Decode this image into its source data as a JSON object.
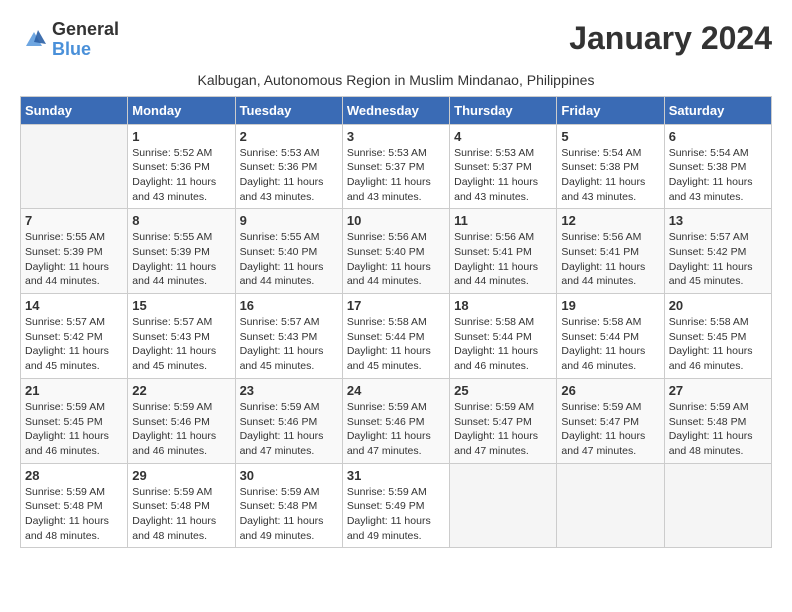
{
  "logo": {
    "line1": "General",
    "line2": "Blue"
  },
  "title": "January 2024",
  "subtitle": "Kalbugan, Autonomous Region in Muslim Mindanao, Philippines",
  "days_header": [
    "Sunday",
    "Monday",
    "Tuesday",
    "Wednesday",
    "Thursday",
    "Friday",
    "Saturday"
  ],
  "weeks": [
    [
      {
        "num": "",
        "sunrise": "",
        "sunset": "",
        "daylight": ""
      },
      {
        "num": "1",
        "sunrise": "Sunrise: 5:52 AM",
        "sunset": "Sunset: 5:36 PM",
        "daylight": "Daylight: 11 hours and 43 minutes."
      },
      {
        "num": "2",
        "sunrise": "Sunrise: 5:53 AM",
        "sunset": "Sunset: 5:36 PM",
        "daylight": "Daylight: 11 hours and 43 minutes."
      },
      {
        "num": "3",
        "sunrise": "Sunrise: 5:53 AM",
        "sunset": "Sunset: 5:37 PM",
        "daylight": "Daylight: 11 hours and 43 minutes."
      },
      {
        "num": "4",
        "sunrise": "Sunrise: 5:53 AM",
        "sunset": "Sunset: 5:37 PM",
        "daylight": "Daylight: 11 hours and 43 minutes."
      },
      {
        "num": "5",
        "sunrise": "Sunrise: 5:54 AM",
        "sunset": "Sunset: 5:38 PM",
        "daylight": "Daylight: 11 hours and 43 minutes."
      },
      {
        "num": "6",
        "sunrise": "Sunrise: 5:54 AM",
        "sunset": "Sunset: 5:38 PM",
        "daylight": "Daylight: 11 hours and 43 minutes."
      }
    ],
    [
      {
        "num": "7",
        "sunrise": "Sunrise: 5:55 AM",
        "sunset": "Sunset: 5:39 PM",
        "daylight": "Daylight: 11 hours and 44 minutes."
      },
      {
        "num": "8",
        "sunrise": "Sunrise: 5:55 AM",
        "sunset": "Sunset: 5:39 PM",
        "daylight": "Daylight: 11 hours and 44 minutes."
      },
      {
        "num": "9",
        "sunrise": "Sunrise: 5:55 AM",
        "sunset": "Sunset: 5:40 PM",
        "daylight": "Daylight: 11 hours and 44 minutes."
      },
      {
        "num": "10",
        "sunrise": "Sunrise: 5:56 AM",
        "sunset": "Sunset: 5:40 PM",
        "daylight": "Daylight: 11 hours and 44 minutes."
      },
      {
        "num": "11",
        "sunrise": "Sunrise: 5:56 AM",
        "sunset": "Sunset: 5:41 PM",
        "daylight": "Daylight: 11 hours and 44 minutes."
      },
      {
        "num": "12",
        "sunrise": "Sunrise: 5:56 AM",
        "sunset": "Sunset: 5:41 PM",
        "daylight": "Daylight: 11 hours and 44 minutes."
      },
      {
        "num": "13",
        "sunrise": "Sunrise: 5:57 AM",
        "sunset": "Sunset: 5:42 PM",
        "daylight": "Daylight: 11 hours and 45 minutes."
      }
    ],
    [
      {
        "num": "14",
        "sunrise": "Sunrise: 5:57 AM",
        "sunset": "Sunset: 5:42 PM",
        "daylight": "Daylight: 11 hours and 45 minutes."
      },
      {
        "num": "15",
        "sunrise": "Sunrise: 5:57 AM",
        "sunset": "Sunset: 5:43 PM",
        "daylight": "Daylight: 11 hours and 45 minutes."
      },
      {
        "num": "16",
        "sunrise": "Sunrise: 5:57 AM",
        "sunset": "Sunset: 5:43 PM",
        "daylight": "Daylight: 11 hours and 45 minutes."
      },
      {
        "num": "17",
        "sunrise": "Sunrise: 5:58 AM",
        "sunset": "Sunset: 5:44 PM",
        "daylight": "Daylight: 11 hours and 45 minutes."
      },
      {
        "num": "18",
        "sunrise": "Sunrise: 5:58 AM",
        "sunset": "Sunset: 5:44 PM",
        "daylight": "Daylight: 11 hours and 46 minutes."
      },
      {
        "num": "19",
        "sunrise": "Sunrise: 5:58 AM",
        "sunset": "Sunset: 5:44 PM",
        "daylight": "Daylight: 11 hours and 46 minutes."
      },
      {
        "num": "20",
        "sunrise": "Sunrise: 5:58 AM",
        "sunset": "Sunset: 5:45 PM",
        "daylight": "Daylight: 11 hours and 46 minutes."
      }
    ],
    [
      {
        "num": "21",
        "sunrise": "Sunrise: 5:59 AM",
        "sunset": "Sunset: 5:45 PM",
        "daylight": "Daylight: 11 hours and 46 minutes."
      },
      {
        "num": "22",
        "sunrise": "Sunrise: 5:59 AM",
        "sunset": "Sunset: 5:46 PM",
        "daylight": "Daylight: 11 hours and 46 minutes."
      },
      {
        "num": "23",
        "sunrise": "Sunrise: 5:59 AM",
        "sunset": "Sunset: 5:46 PM",
        "daylight": "Daylight: 11 hours and 47 minutes."
      },
      {
        "num": "24",
        "sunrise": "Sunrise: 5:59 AM",
        "sunset": "Sunset: 5:46 PM",
        "daylight": "Daylight: 11 hours and 47 minutes."
      },
      {
        "num": "25",
        "sunrise": "Sunrise: 5:59 AM",
        "sunset": "Sunset: 5:47 PM",
        "daylight": "Daylight: 11 hours and 47 minutes."
      },
      {
        "num": "26",
        "sunrise": "Sunrise: 5:59 AM",
        "sunset": "Sunset: 5:47 PM",
        "daylight": "Daylight: 11 hours and 47 minutes."
      },
      {
        "num": "27",
        "sunrise": "Sunrise: 5:59 AM",
        "sunset": "Sunset: 5:48 PM",
        "daylight": "Daylight: 11 hours and 48 minutes."
      }
    ],
    [
      {
        "num": "28",
        "sunrise": "Sunrise: 5:59 AM",
        "sunset": "Sunset: 5:48 PM",
        "daylight": "Daylight: 11 hours and 48 minutes."
      },
      {
        "num": "29",
        "sunrise": "Sunrise: 5:59 AM",
        "sunset": "Sunset: 5:48 PM",
        "daylight": "Daylight: 11 hours and 48 minutes."
      },
      {
        "num": "30",
        "sunrise": "Sunrise: 5:59 AM",
        "sunset": "Sunset: 5:48 PM",
        "daylight": "Daylight: 11 hours and 49 minutes."
      },
      {
        "num": "31",
        "sunrise": "Sunrise: 5:59 AM",
        "sunset": "Sunset: 5:49 PM",
        "daylight": "Daylight: 11 hours and 49 minutes."
      },
      {
        "num": "",
        "sunrise": "",
        "sunset": "",
        "daylight": ""
      },
      {
        "num": "",
        "sunrise": "",
        "sunset": "",
        "daylight": ""
      },
      {
        "num": "",
        "sunrise": "",
        "sunset": "",
        "daylight": ""
      }
    ]
  ]
}
